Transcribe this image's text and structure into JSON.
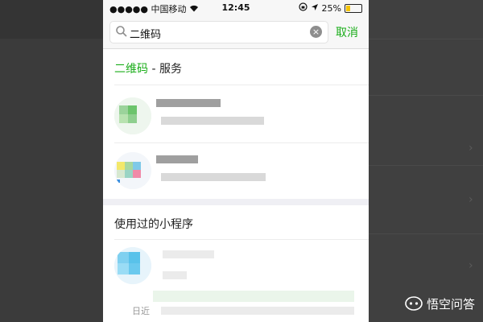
{
  "status": {
    "carrier": "●●●●● 中国移动",
    "time": "12:45",
    "battery_percent": "25%",
    "battery_level": 0.25
  },
  "search": {
    "query": "二维码",
    "cancel_label": "取消"
  },
  "results": {
    "services_keyword": "二维码",
    "services_suffix": " - 服务",
    "used_miniprograms_title": "使用过的小程序",
    "recent_prefix": "日近"
  },
  "watermark": {
    "text": "悟空问答"
  },
  "colors": {
    "accent": "#1aad19",
    "battery": "#f4c400"
  }
}
